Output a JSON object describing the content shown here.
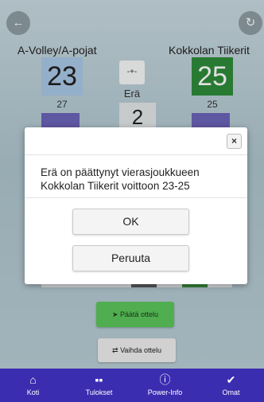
{
  "header": {
    "back_icon": "arrow-left-icon",
    "refresh_icon": "refresh-icon",
    "home_team": "A-Volley/A-pojat",
    "away_team": "Kokkolan Tiikerit",
    "home_score": "23",
    "away_score": "25",
    "home_sub": "27",
    "away_sub": "25",
    "swap_icon": "-+-",
    "era_label": "Erä",
    "era_number": "2",
    "home_color": "#a9c8e6",
    "away_color": "#2e8b3a"
  },
  "dialog": {
    "close_label": "×",
    "message": "Erä on päättynyt vierasjoukkueen Kokkolan Tiikerit voittoon 23-25",
    "ok_label": "OK",
    "cancel_label": "Peruuta"
  },
  "actions": {
    "end_match_label": "Päätä ottelu",
    "end_match_icon": "➤",
    "change_match_label": "Vaihda ottelu",
    "change_match_icon": "⇄",
    "end_match_color": "#5cc65c"
  },
  "nav": {
    "items": [
      {
        "label": "Koti",
        "icon": "⌂"
      },
      {
        "label": "Tulokset",
        "icon": "▪▪"
      },
      {
        "label": "Power-Info",
        "icon": "ⓘ"
      },
      {
        "label": "Omat",
        "icon": "✔"
      }
    ]
  }
}
